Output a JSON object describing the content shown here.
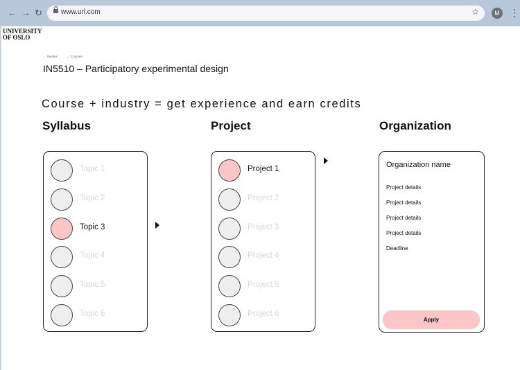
{
  "browser": {
    "url": "www.url.com",
    "avatar_letter": "M"
  },
  "logo": {
    "line1": "UNIVERSITY",
    "line2": "OF OSLO"
  },
  "breadcrumb": [
    "Studies",
    "Courses"
  ],
  "course_title": "IN5510 – Participatory experimental design",
  "tagline": "Course + industry = get experience and earn credits",
  "columns": {
    "syllabus": "Syllabus",
    "project": "Project",
    "organization": "Organization"
  },
  "syllabus": {
    "items": [
      {
        "label": "Topic 1",
        "selected": false
      },
      {
        "label": "Topic 2",
        "selected": false
      },
      {
        "label": "Topic 3",
        "selected": true
      },
      {
        "label": "Topic 4",
        "selected": false
      },
      {
        "label": "Topic 5",
        "selected": false
      },
      {
        "label": "Topic 6",
        "selected": false
      }
    ]
  },
  "project": {
    "items": [
      {
        "label": "Project 1",
        "selected": true
      },
      {
        "label": "Project 2",
        "selected": false
      },
      {
        "label": "Project 3",
        "selected": false
      },
      {
        "label": "Project 4",
        "selected": false
      },
      {
        "label": "Project 5",
        "selected": false
      },
      {
        "label": "Project 6",
        "selected": false
      }
    ]
  },
  "organization": {
    "name": "Organization name",
    "details": [
      "Project details",
      "Project details",
      "Project details",
      "Project details",
      "Deadline"
    ],
    "apply_label": "Apply"
  },
  "colors": {
    "selected": "#fcc6c6",
    "unselected": "#eeeeee",
    "muted_text": "#d8d8d8"
  }
}
